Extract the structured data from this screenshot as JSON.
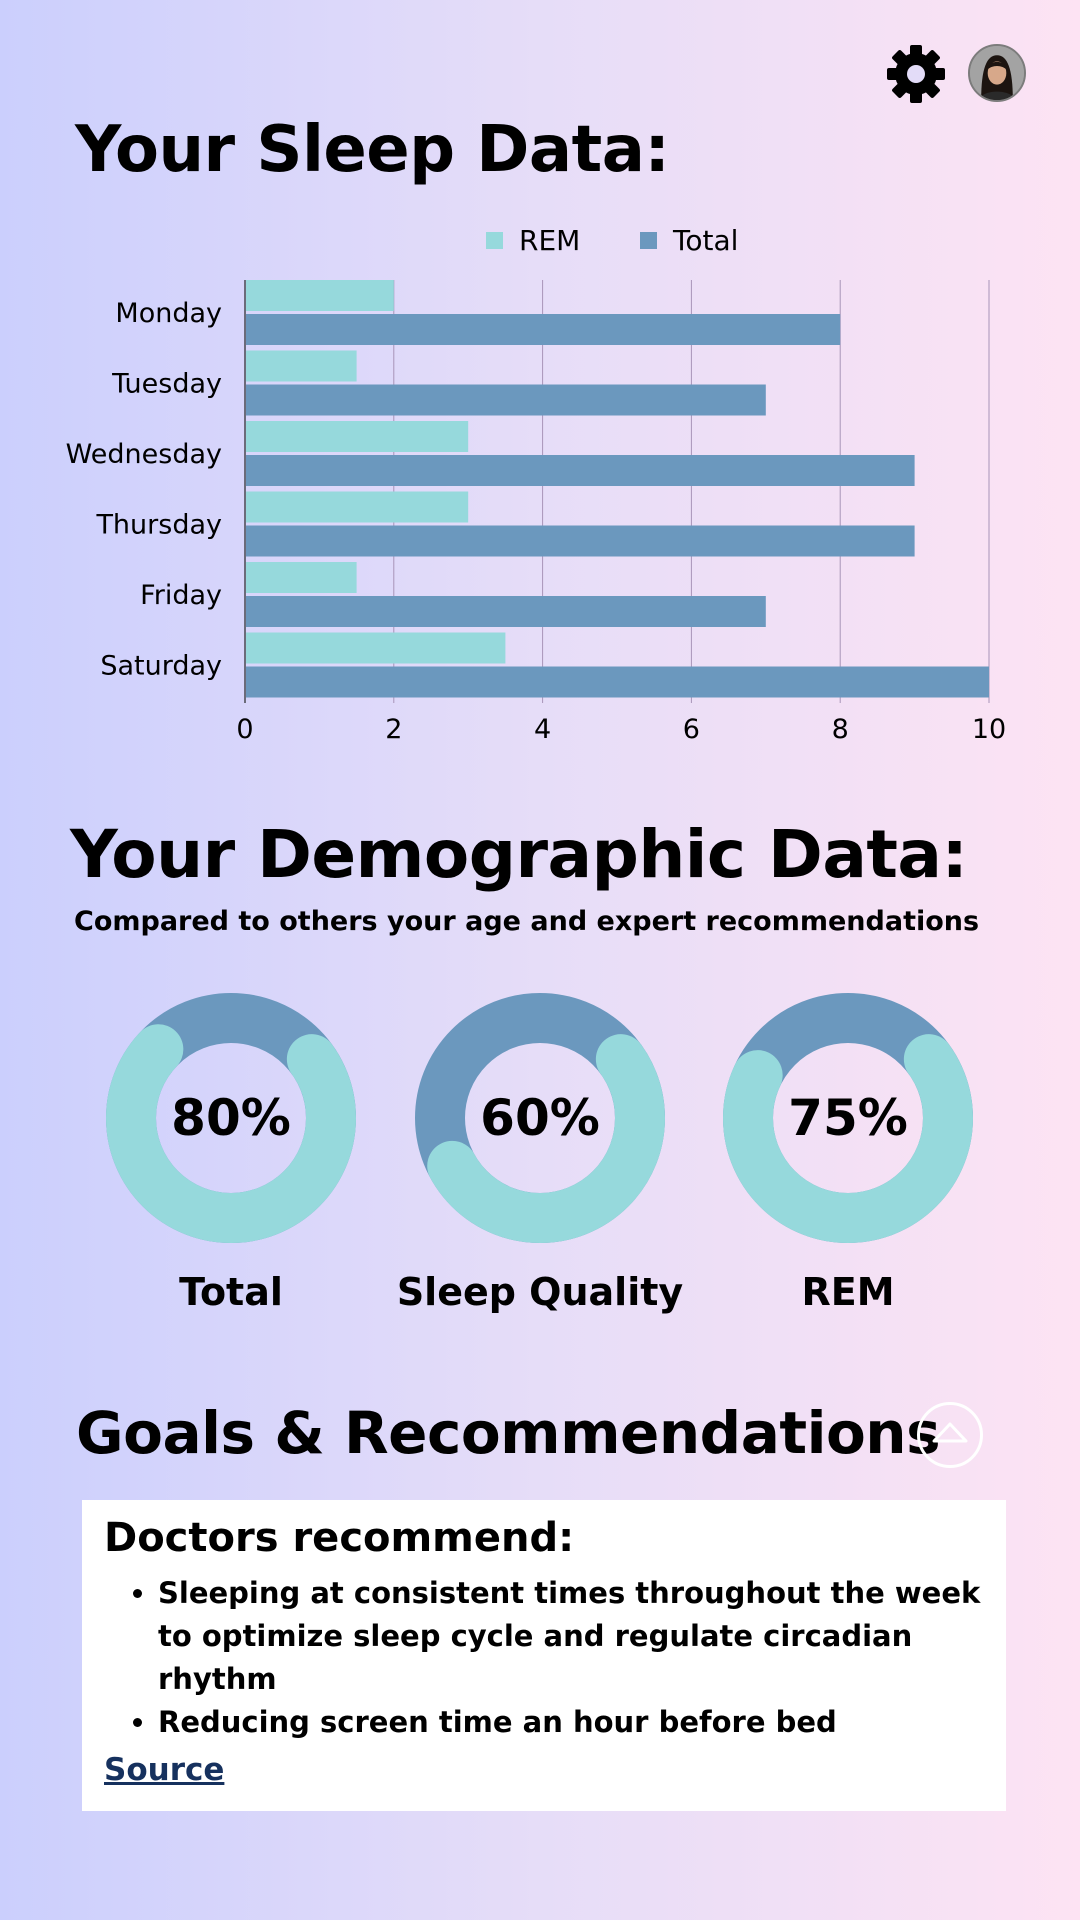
{
  "header": {
    "settings_icon": "gear-icon",
    "avatar_icon": "user-avatar"
  },
  "sleep_section": {
    "title": "Your Sleep Data:"
  },
  "chart_data": {
    "type": "bar",
    "orientation": "horizontal",
    "categories": [
      "Monday",
      "Tuesday",
      "Wednesday",
      "Thursday",
      "Friday",
      "Saturday"
    ],
    "series": [
      {
        "name": "REM",
        "color": "#96d9dc",
        "values": [
          2,
          1.5,
          3,
          3,
          1.5,
          3.5
        ]
      },
      {
        "name": "Total",
        "color": "#6b98be",
        "values": [
          8,
          7,
          9,
          9,
          7,
          10
        ]
      }
    ],
    "xlim": [
      0,
      10
    ],
    "xticks": [
      "0",
      "2",
      "4",
      "6",
      "8",
      "10"
    ],
    "grid": true,
    "legend": "top"
  },
  "demographic_section": {
    "title": "Your Demographic Data:",
    "subtitle": "Compared to others your age and expert recommendations",
    "rings": [
      {
        "value": 80,
        "display": "80%",
        "label": "Total"
      },
      {
        "value": 60,
        "display": "60%",
        "label": "Sleep Quality"
      },
      {
        "value": 75,
        "display": "75%",
        "label": "REM"
      }
    ],
    "colors": {
      "filled": "#96d9dc",
      "remaining": "#6b98be"
    }
  },
  "goals_section": {
    "title": "Goals & Recommendations",
    "collapse_icon": "chevron-up-icon",
    "card": {
      "title": "Doctors recommend:",
      "items": [
        "Sleeping at consistent times throughout the week to optimize sleep cycle and regulate circadian rhythm",
        "Reducing screen time an hour before bed"
      ],
      "link": "Source"
    }
  }
}
